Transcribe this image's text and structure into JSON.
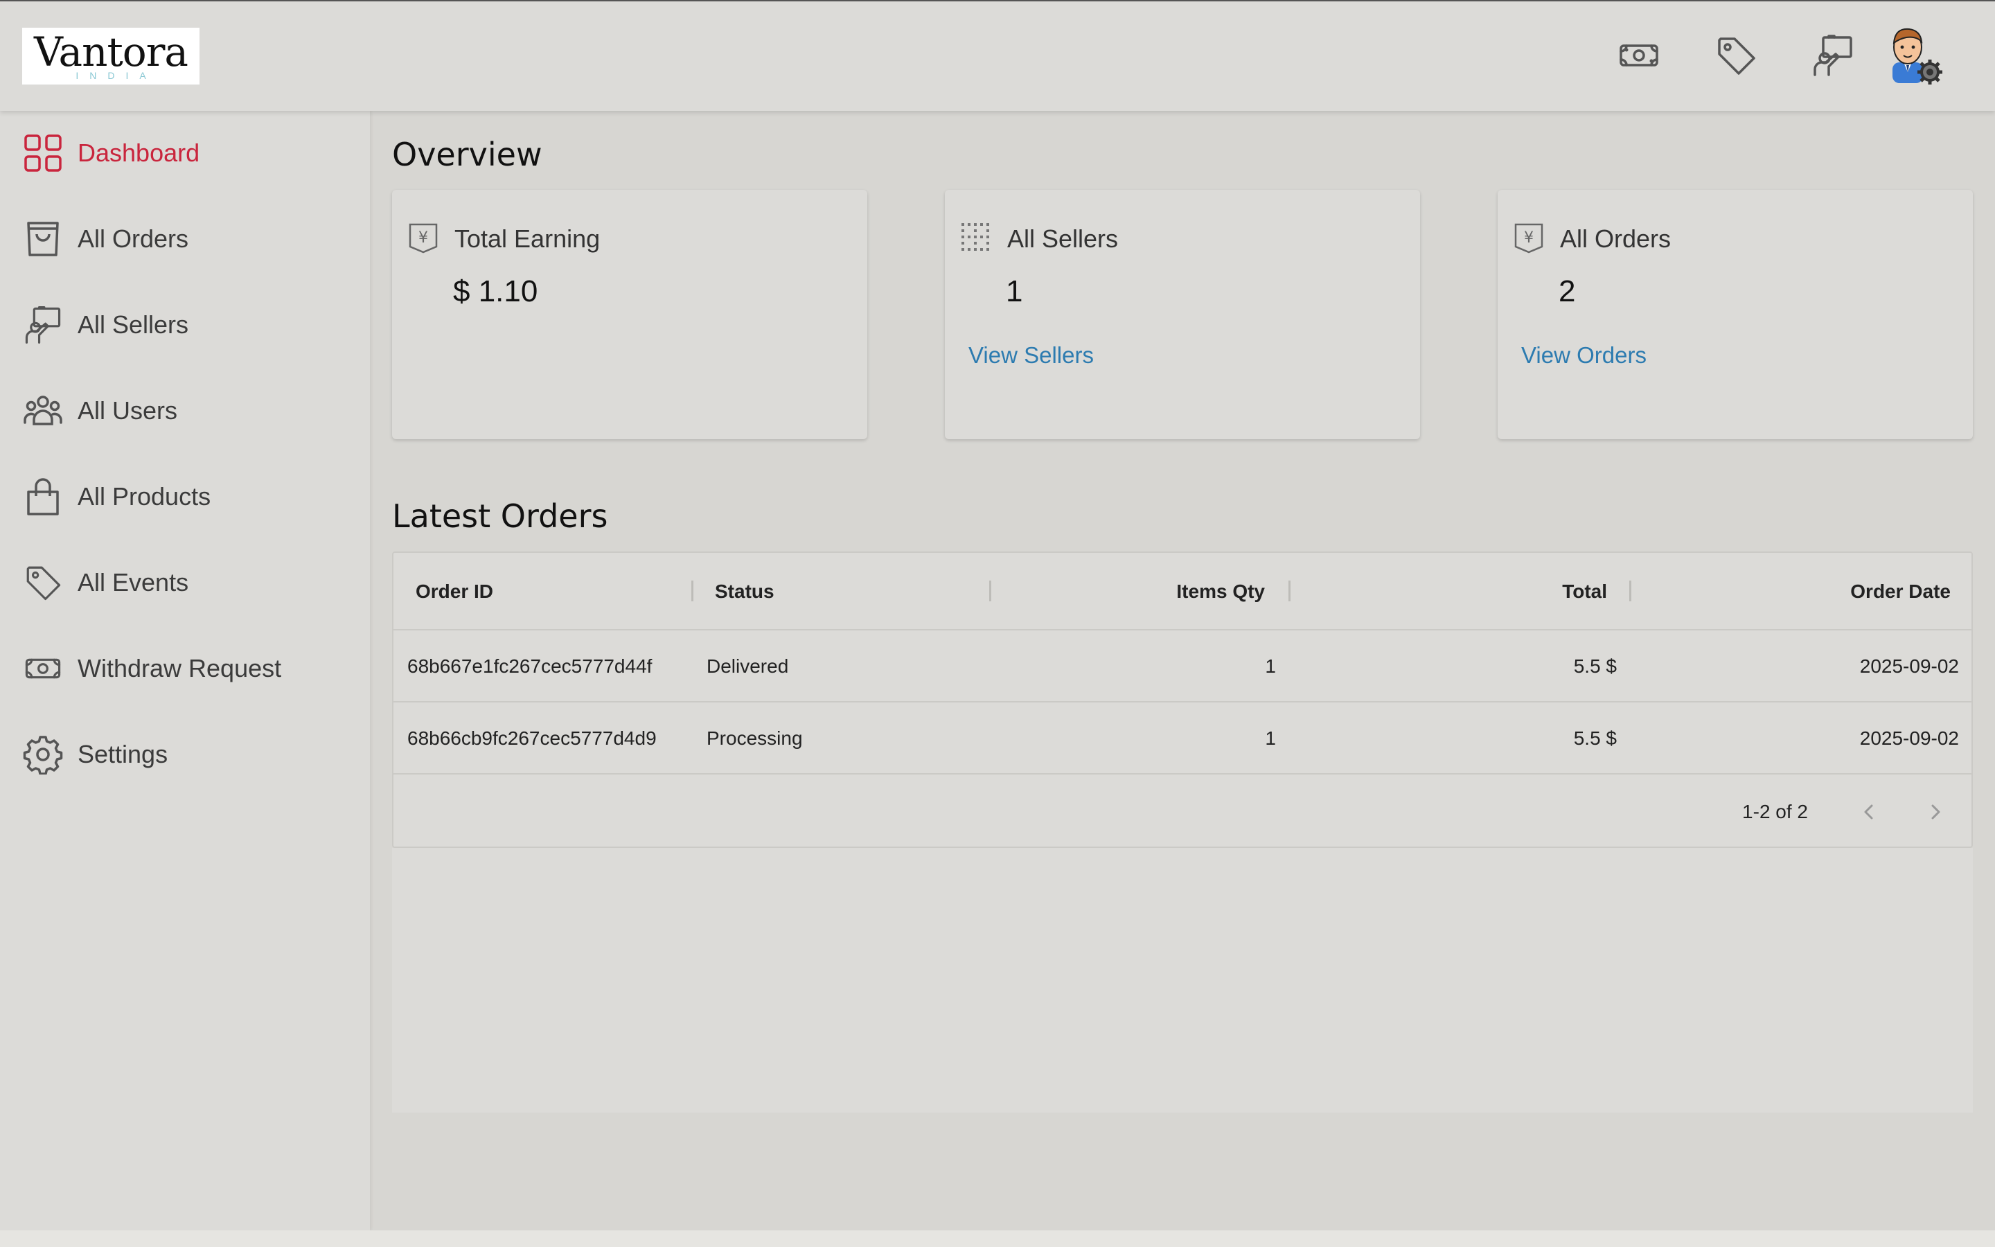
{
  "header": {
    "logo_main": "Vantora",
    "logo_sub": "INDIA",
    "icons": [
      "money-icon",
      "tag-icon",
      "seller-icon"
    ],
    "avatar": "admin-avatar"
  },
  "sidebar": {
    "items": [
      {
        "label": "Dashboard",
        "icon": "dashboard-icon",
        "active": true
      },
      {
        "label": "All Orders",
        "icon": "shopping-bag-icon"
      },
      {
        "label": "All Sellers",
        "icon": "seller-icon"
      },
      {
        "label": "All Users",
        "icon": "users-icon"
      },
      {
        "label": "All Products",
        "icon": "product-bag-icon"
      },
      {
        "label": "All Events",
        "icon": "tag-icon"
      },
      {
        "label": "Withdraw Request",
        "icon": "money-icon"
      },
      {
        "label": "Settings",
        "icon": "gear-icon"
      }
    ],
    "active_color": "#c9253d"
  },
  "overview": {
    "title": "Overview",
    "cards": [
      {
        "title": "Total Earning",
        "value": "$ 1.10",
        "link": ""
      },
      {
        "title": "All Sellers",
        "value": "1",
        "link": "View Sellers"
      },
      {
        "title": "All Orders",
        "value": "2",
        "link": "View Orders"
      }
    ],
    "link_color": "#2c7bb0"
  },
  "latest_orders": {
    "title": "Latest Orders",
    "columns": [
      "Order ID",
      "Status",
      "Items Qty",
      "Total",
      "Order Date"
    ],
    "rows": [
      [
        "68b667e1fc267cec5777d44f",
        "Delivered",
        "1",
        "5.5 $",
        "2025-09-02"
      ],
      [
        "68b66cb9fc267cec5777d4d9",
        "Processing",
        "1",
        "5.5 $",
        "2025-09-02"
      ]
    ],
    "pagination": "1-2 of 2"
  }
}
